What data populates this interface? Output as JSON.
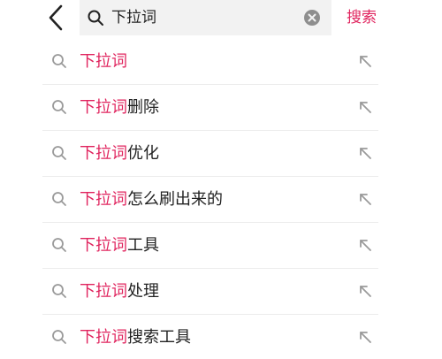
{
  "header": {
    "query": "下拉词",
    "search_label": "搜索",
    "back_icon": "chevron-left-icon",
    "search_icon": "search-icon",
    "clear_icon": "clear-icon"
  },
  "suggestions": [
    {
      "highlight": "下拉词",
      "rest": ""
    },
    {
      "highlight": "下拉词",
      "rest": "删除"
    },
    {
      "highlight": "下拉词",
      "rest": "优化"
    },
    {
      "highlight": "下拉词",
      "rest": "怎么刷出来的"
    },
    {
      "highlight": "下拉词",
      "rest": "工具"
    },
    {
      "highlight": "下拉词",
      "rest": "处理"
    },
    {
      "highlight": "下拉词",
      "rest": "搜索工具"
    }
  ],
  "colors": {
    "accent": "#e0245e",
    "text": "#222222",
    "icon": "#9a9a9a",
    "search_bg": "#f2f2f2",
    "divider": "#ececec"
  }
}
